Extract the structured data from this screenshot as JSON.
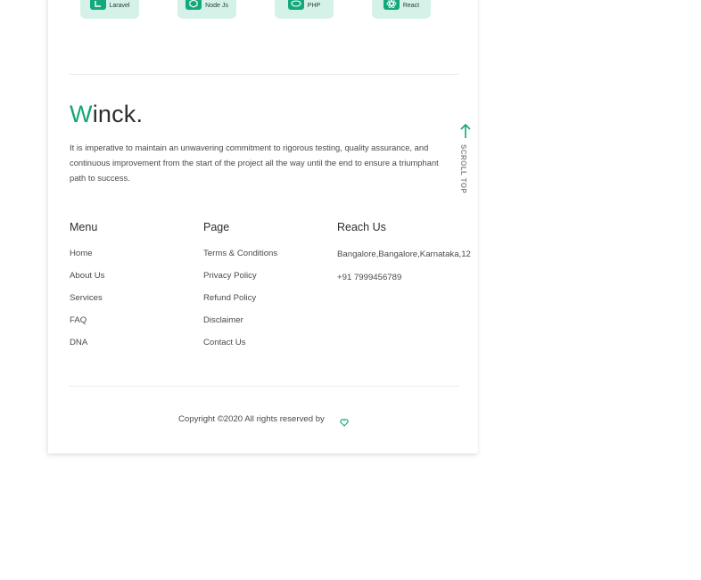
{
  "tech_badges": [
    {
      "label": "Laravel",
      "icon": "laravel-icon"
    },
    {
      "label": "Node Js",
      "icon": "nodejs-icon"
    },
    {
      "label": "PHP",
      "icon": "php-icon"
    },
    {
      "label": "React",
      "icon": "react-icon"
    }
  ],
  "brand": {
    "first_letter": "W",
    "rest": "inck."
  },
  "tagline": "It is imperative to maintain an unwavering commitment to rigorous testing, quality assurance, and continuous improvement from the start of the project all the way until the end to ensure a triumphant path to success.",
  "scroll_top": {
    "label": "SCROLL TOP"
  },
  "menu": {
    "title": "Menu",
    "items": [
      "Home",
      "About Us",
      "Services",
      "FAQ",
      "DNA"
    ]
  },
  "page": {
    "title": "Page",
    "items": [
      "Terms & Conditions",
      "Privacy Policy",
      "Refund Policy",
      "Disclaimer",
      "Contact Us"
    ]
  },
  "reach": {
    "title": "Reach Us",
    "address": "Bangalore,Bangalore,Karnataka,12",
    "phone": "+91 7999456789"
  },
  "footer": {
    "copyright": "Copyright ©2020 All rights reserved by"
  },
  "colors": {
    "accent": "#12a57a",
    "badge_bg": "#d5f2e9"
  }
}
